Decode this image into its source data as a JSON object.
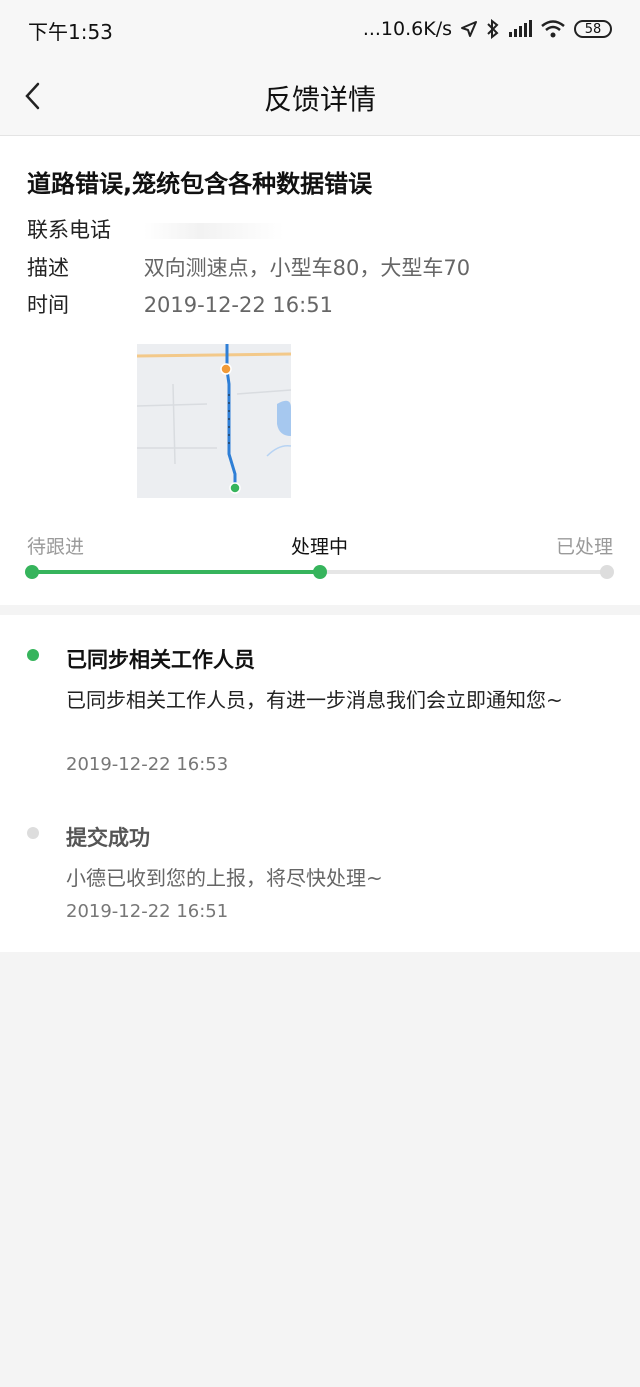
{
  "status_bar": {
    "time": "下午1:53",
    "net_speed": "...10.6K/s",
    "battery": "58",
    "icons": [
      "location-arrow-icon",
      "bluetooth-icon",
      "signal-icon",
      "wifi-icon",
      "battery-icon"
    ]
  },
  "navbar": {
    "title": "反馈详情",
    "back_icon": "chevron-left-icon"
  },
  "feedback": {
    "title": "道路错误,笼统包含各种数据错误",
    "phone_label": "联系电话",
    "desc_label": "描述",
    "desc_value": "双向测速点，小型车80，大型车70",
    "time_label": "时间",
    "time_value": "2019-12-22 16:51"
  },
  "progress": {
    "steps": [
      "待跟进",
      "处理中",
      "已处理"
    ],
    "current_index": 1,
    "fraction": 0.5
  },
  "timeline": [
    {
      "title": "已同步相关工作人员",
      "desc": "已同步相关工作人员，有进一步消息我们会立即通知您~",
      "time": "2019-12-22 16:53",
      "active": true
    },
    {
      "title": "提交成功",
      "desc": "小德已收到您的上报，将尽快处理~",
      "time": "2019-12-22 16:51",
      "active": false
    }
  ],
  "colors": {
    "accent_green": "#36b45c",
    "inactive_gray": "#dddddd"
  }
}
